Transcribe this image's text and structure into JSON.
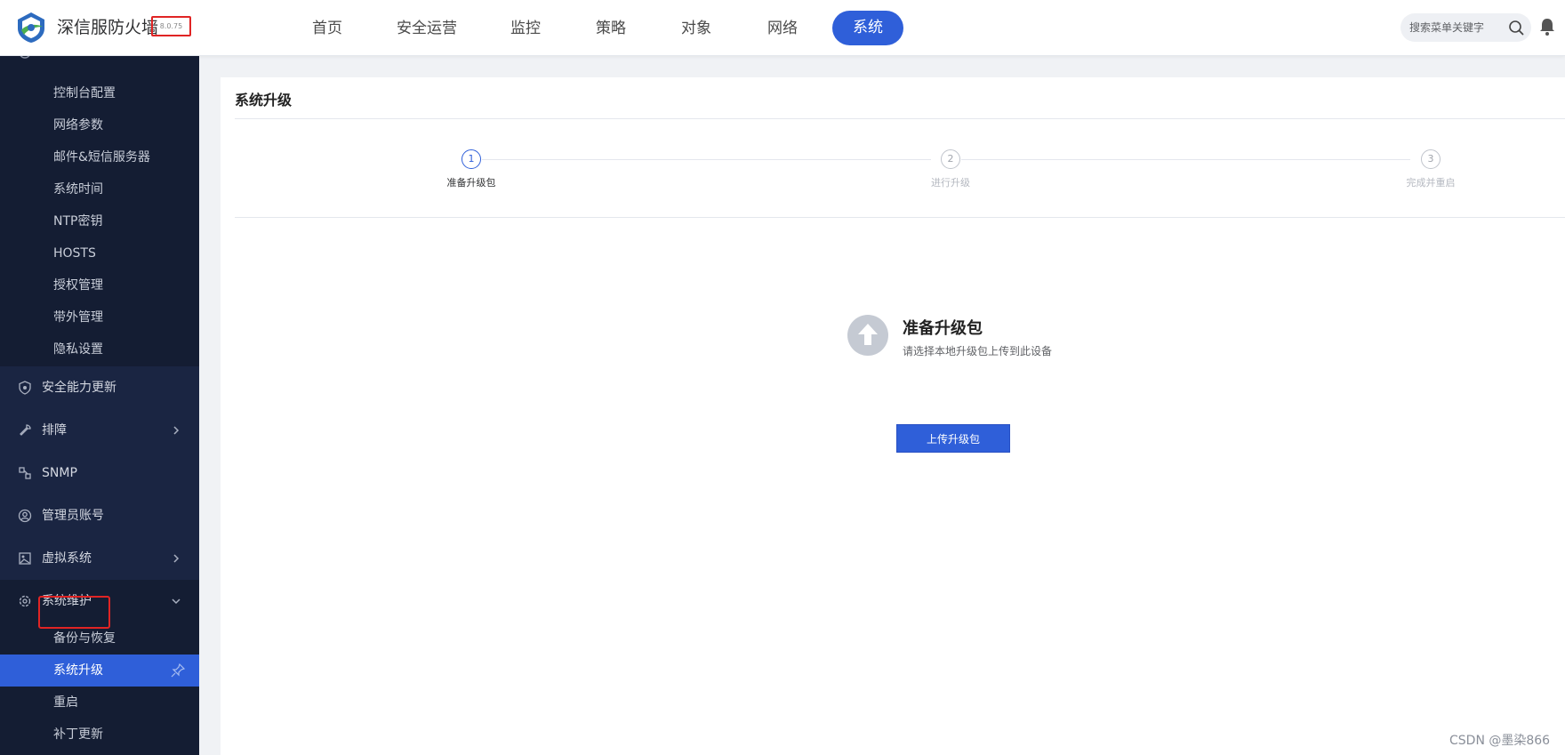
{
  "header": {
    "brand": "深信服防火墙",
    "version": "8.0.75",
    "nav": [
      "首页",
      "安全运营",
      "监控",
      "策略",
      "对象",
      "网络",
      "系统"
    ],
    "active_nav": "系统",
    "search_placeholder": "搜索菜单关键字",
    "accent_color": "#2f5fd9"
  },
  "sidebar": {
    "sub_items_top": [
      "控制台配置",
      "网络参数",
      "邮件&短信服务器",
      "系统时间",
      "NTP密钥",
      "HOSTS",
      "授权管理",
      "带外管理",
      "隐私设置"
    ],
    "groups": {
      "security_update": "安全能力更新",
      "troubleshoot": "排障",
      "snmp": "SNMP",
      "admin_account": "管理员账号",
      "virtual_system": "虚拟系统",
      "system_maintenance": "系统维护"
    },
    "maintenance_items": [
      "备份与恢复",
      "系统升级",
      "重启",
      "补丁更新"
    ],
    "active_item": "系统升级"
  },
  "main": {
    "title": "系统升级",
    "steps": [
      {
        "num": "1",
        "label": "准备升级包",
        "state": "current"
      },
      {
        "num": "2",
        "label": "进行升级",
        "state": "pending"
      },
      {
        "num": "3",
        "label": "完成并重启",
        "state": "pending"
      }
    ],
    "prep_title": "准备升级包",
    "prep_desc": "请选择本地升级包上传到此设备",
    "upload_button": "上传升级包"
  },
  "watermark": "CSDN @墨染866"
}
